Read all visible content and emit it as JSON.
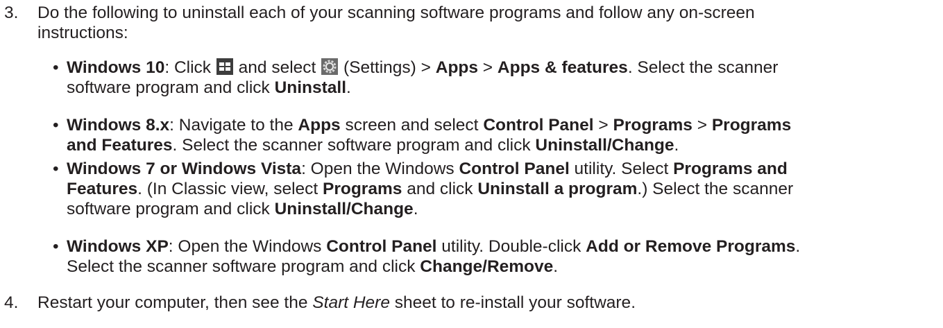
{
  "step3": {
    "number": "3.",
    "line1": "Do the following to uninstall each of your scanning software programs and follow any on-screen",
    "line2": "instructions:"
  },
  "bullets": [
    {
      "os": "Windows 10",
      "parts": [
        ": Click ",
        " and select ",
        " (Settings) > ",
        "Apps",
        " > ",
        "Apps & features",
        ". Select the scanner",
        "software program and click ",
        "Uninstall",
        "."
      ],
      "icons": [
        "windows-start-icon",
        "settings-gear-icon"
      ]
    },
    {
      "os": "Windows 8.x",
      "parts": [
        ": Navigate to the ",
        "Apps",
        " screen and select ",
        "Control Panel",
        " > ",
        "Programs",
        " > ",
        "Programs",
        "and Features",
        ". Select the scanner software program and click ",
        "Uninstall/Change",
        "."
      ]
    },
    {
      "os": "Windows 7 or Windows Vista",
      "parts": [
        ": Open the Windows ",
        "Control Panel",
        " utility. Select ",
        "Programs and",
        "Features",
        ". (In Classic view, select ",
        "Programs",
        " and click ",
        "Uninstall a program",
        ".) Select the scanner",
        "software program and click ",
        "Uninstall/Change",
        "."
      ]
    },
    {
      "os": "Windows XP",
      "parts": [
        ": Open the Windows ",
        "Control Panel",
        " utility. Double-click ",
        "Add or Remove Programs",
        ".",
        "Select the scanner software program and click ",
        "Change/Remove",
        "."
      ]
    }
  ],
  "step4": {
    "number": "4.",
    "pre": "Restart your computer, then see the ",
    "italic": "Start Here",
    "post": " sheet to re-install your software."
  },
  "bullet_char": "•",
  "colors": {
    "text": "#231f20",
    "icon_dark": "#3a3a3a"
  }
}
